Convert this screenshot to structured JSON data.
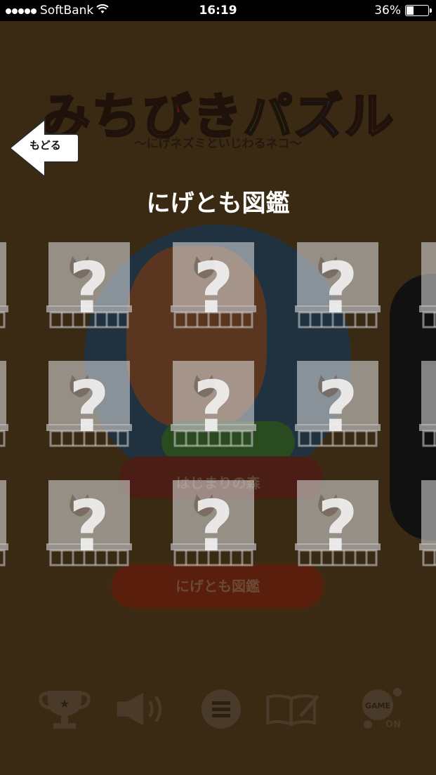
{
  "status_bar": {
    "carrier": "SoftBank",
    "time": "16:19",
    "battery": "36%",
    "battery_level": 0.36
  },
  "background": {
    "game_title": [
      "みちびき",
      "パ",
      "ズ",
      "ル"
    ],
    "subtitle": "〜にげネズミといじわるネコ〜",
    "stage_name": "はじまりの森",
    "zukan_button": "にげとも図鑑"
  },
  "overlay": {
    "back_button": "もどる",
    "heading": "にげとも図鑑",
    "locked_symbol": "?"
  },
  "toolbar": {
    "icons": [
      "trophy-icon",
      "speaker-icon",
      "menu-icon",
      "book-icon",
      "game-on-icon"
    ],
    "game_label": "GAME",
    "on_label": "ON"
  },
  "grid": {
    "rows": 3,
    "columns": 5,
    "locked_count": 15
  }
}
